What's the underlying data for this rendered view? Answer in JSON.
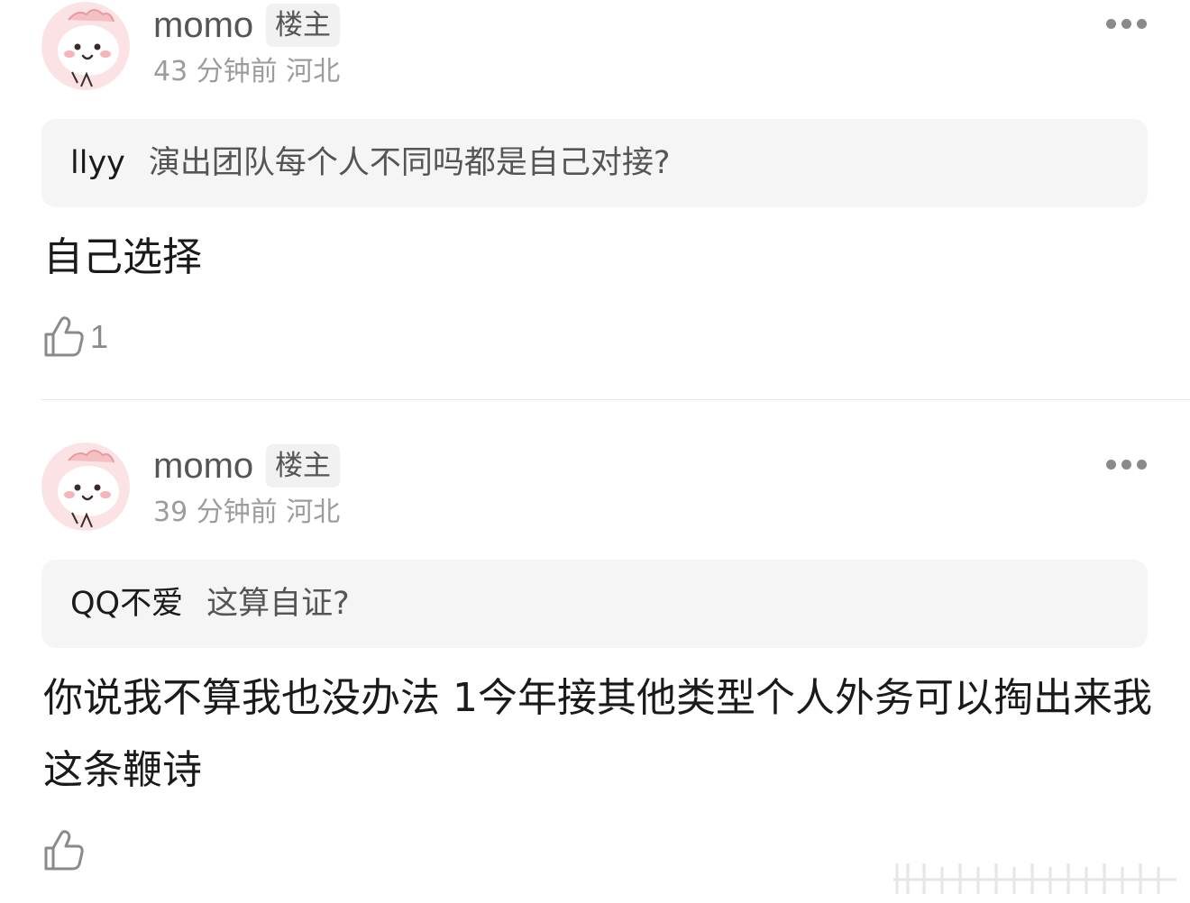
{
  "comments": [
    {
      "username": "momo",
      "badge": "楼主",
      "time": "43 分钟前",
      "location": "河北",
      "quote_author": "llyy",
      "quote_text": "演出团队每个人不同吗都是自己对接?",
      "text": "自己选择",
      "likes": "1"
    },
    {
      "username": "momo",
      "badge": "楼主",
      "time": "39 分钟前",
      "location": "河北",
      "quote_author": "QQ不爱",
      "quote_text": "这算自证?",
      "text": "你说我不算我也没办法 1今年接其他类型个人外务可以掏出来我这条鞭诗",
      "likes": ""
    }
  ],
  "icons": {
    "avatar": "cartoon-avatar-icon",
    "more": "more-dots-icon",
    "like": "thumbs-up-icon"
  },
  "colors": {
    "username": "#555555",
    "meta": "#9c9c9c",
    "quote_bg": "#f5f5f5",
    "badge_bg": "#f1f1f1",
    "avatar_bg": "#fbe3e5"
  }
}
